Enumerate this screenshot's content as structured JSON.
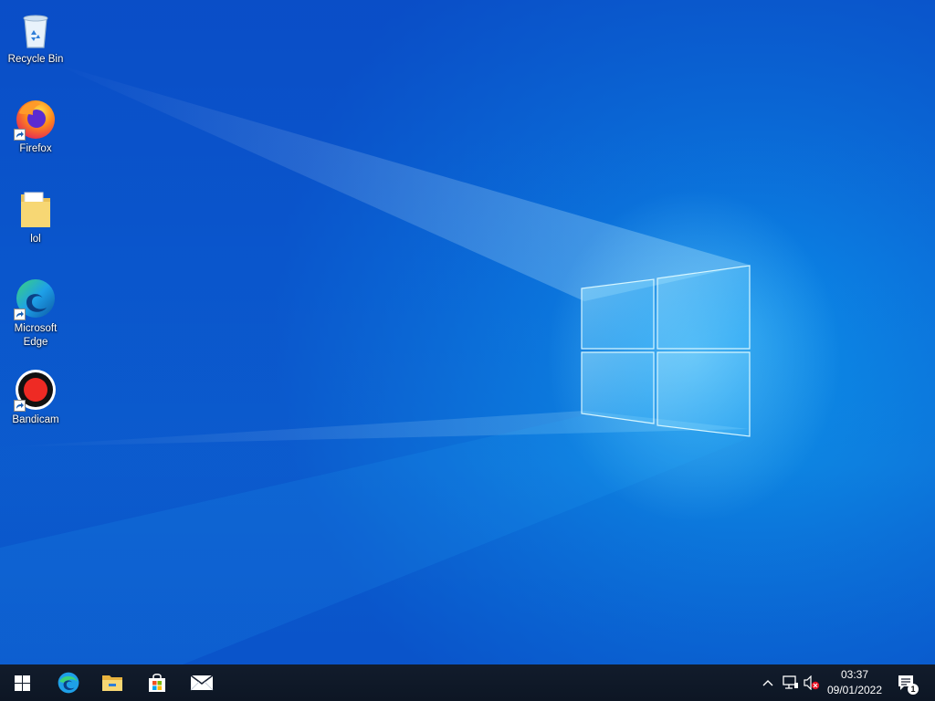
{
  "desktop": {
    "icons": [
      {
        "label": "Recycle Bin",
        "icon": "recycle-bin-icon"
      },
      {
        "label": "Firefox",
        "icon": "firefox-icon"
      },
      {
        "label": "lol",
        "icon": "folder-icon"
      },
      {
        "label": "Microsoft\nEdge",
        "icon": "edge-icon"
      },
      {
        "label": "Bandicam",
        "icon": "bandicam-icon"
      }
    ]
  },
  "taskbar": {
    "pinned": [
      "start-icon",
      "edge-icon",
      "file-explorer-icon",
      "store-icon",
      "mail-icon"
    ],
    "tray": [
      "chevron-up-icon",
      "network-icon",
      "volume-muted-icon"
    ],
    "clock_time": "03:37",
    "clock_date": "09/01/2022",
    "notification_count": "1"
  },
  "colors": {
    "taskbar": "#121c2c",
    "wallpaper_accent": "#0a7fe0"
  }
}
